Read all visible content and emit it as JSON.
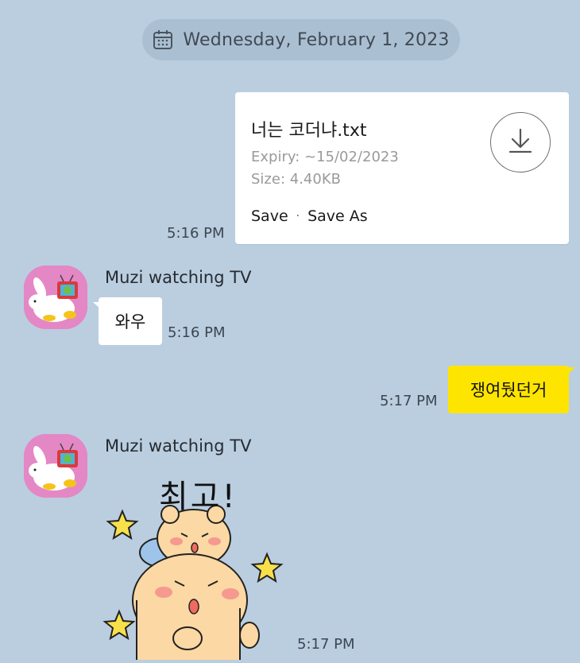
{
  "date_divider": {
    "text": "Wednesday, February 1, 2023",
    "icon": "calendar-icon"
  },
  "messages": [
    {
      "type": "file",
      "direction": "outgoing",
      "file_name": "너는 코더냐.txt",
      "expiry": "Expiry: ~15/02/2023",
      "size": "Size: 4.40KB",
      "actions": [
        "Save",
        "Save As"
      ],
      "action_separator": "·",
      "icon": "download-icon",
      "time": "5:16 PM"
    },
    {
      "type": "text",
      "direction": "incoming",
      "sender": "Muzi watching TV",
      "text": "와우",
      "time": "5:16 PM"
    },
    {
      "type": "text",
      "direction": "outgoing",
      "text": "쟁여뒀던거",
      "time": "5:17 PM"
    },
    {
      "type": "sticker",
      "direction": "incoming",
      "sender": "Muzi watching TV",
      "sticker_text": "최고!",
      "sticker": "bear-thumbs-up-sticker",
      "time": "5:17 PM"
    }
  ],
  "colors": {
    "background": "#bacee0",
    "outgoing_bubble": "#fee500",
    "incoming_bubble": "#ffffff",
    "avatar": "#e487c5"
  }
}
